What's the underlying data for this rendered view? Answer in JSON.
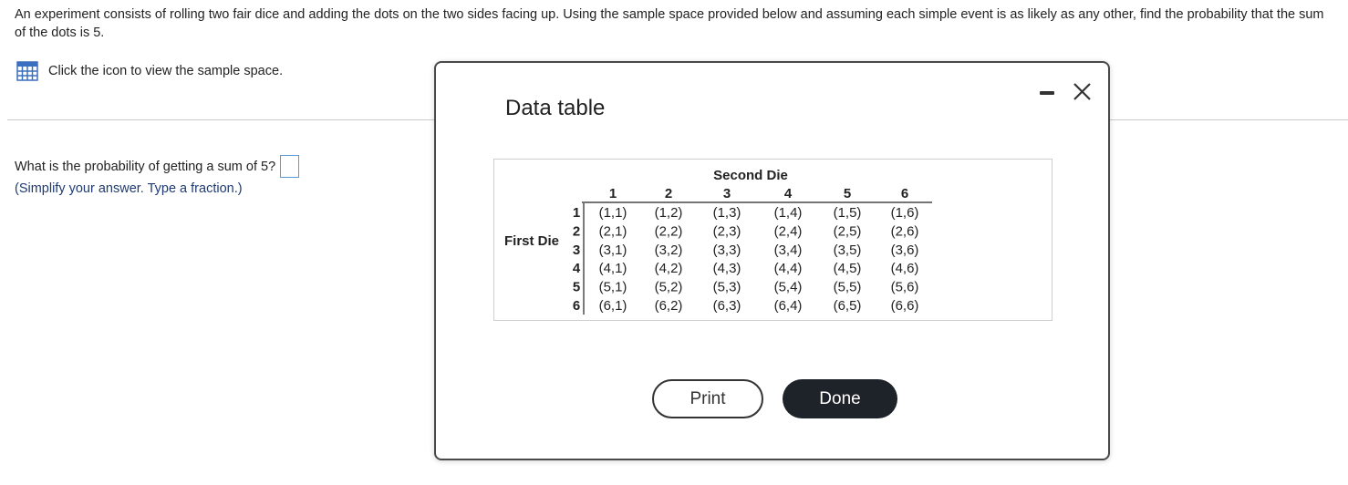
{
  "problem_text": "An experiment consists of rolling two fair dice and adding the dots on the two sides facing up. Using the sample space provided below and assuming each simple event is as likely as any other, find the probability that the sum of the dots is 5.",
  "sample_link_text": "Click the icon to view the sample space.",
  "question": {
    "prompt": "What is the probability of getting a sum of 5?",
    "hint": "(Simplify your answer. Type a fraction.)",
    "answer_value": ""
  },
  "modal": {
    "title": "Data table",
    "print_label": "Print",
    "done_label": "Done"
  },
  "data_table": {
    "column_group_label": "Second Die",
    "row_group_label": "First Die",
    "column_headers": [
      "1",
      "2",
      "3",
      "4",
      "5",
      "6"
    ],
    "row_headers": [
      "1",
      "2",
      "3",
      "4",
      "5",
      "6"
    ],
    "cells": [
      [
        "(1,1)",
        "(1,2)",
        "(1,3)",
        "(1,4)",
        "(1,5)",
        "(1,6)"
      ],
      [
        "(2,1)",
        "(2,2)",
        "(2,3)",
        "(2,4)",
        "(2,5)",
        "(2,6)"
      ],
      [
        "(3,1)",
        "(3,2)",
        "(3,3)",
        "(3,4)",
        "(3,5)",
        "(3,6)"
      ],
      [
        "(4,1)",
        "(4,2)",
        "(4,3)",
        "(4,4)",
        "(4,5)",
        "(4,6)"
      ],
      [
        "(5,1)",
        "(5,2)",
        "(5,3)",
        "(5,4)",
        "(5,5)",
        "(5,6)"
      ],
      [
        "(6,1)",
        "(6,2)",
        "(6,3)",
        "(6,4)",
        "(6,5)",
        "(6,6)"
      ]
    ]
  },
  "icons": {
    "sample_space": "table-grid-icon",
    "minimize": "minimize-icon",
    "close": "close-icon"
  },
  "colors": {
    "link_icon": "#3b6fc0",
    "answer_border": "#5b9bd5",
    "hint_text": "#1f3b72",
    "done_button": "#1e2229"
  }
}
